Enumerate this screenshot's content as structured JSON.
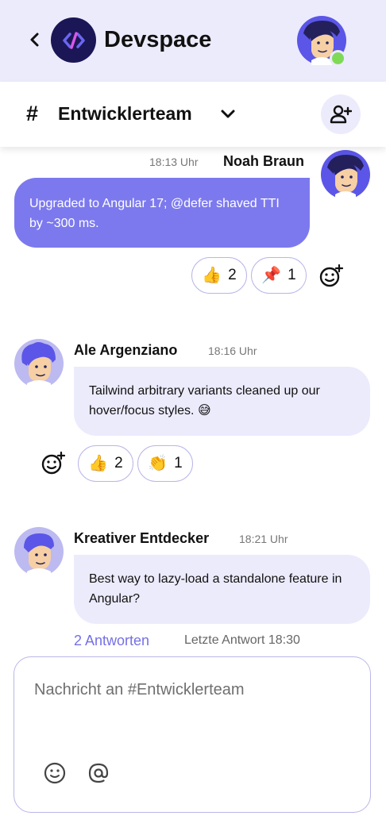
{
  "app": {
    "title": "Devspace",
    "logo_icon": "code-logo-icon",
    "brand_color": "#1b1756",
    "accent_color": "#7c79ee",
    "status": "online"
  },
  "channel": {
    "hash": "#",
    "name": "Entwicklerteam"
  },
  "messages": [
    {
      "author": "Noah Braun",
      "time": "18:13 Uhr",
      "text": "Upgraded to Angular 17; @defer shaved TTI by ~300 ms.",
      "outgoing": true,
      "reactions": [
        {
          "emoji": "👍",
          "count": "2"
        },
        {
          "emoji": "📌",
          "count": "1"
        }
      ]
    },
    {
      "author": "Ale Argenziano",
      "time": "18:16 Uhr",
      "text": "Tailwind arbitrary variants cleaned up our hover/focus styles. 😅",
      "outgoing": false,
      "reactions": [
        {
          "emoji": "👍",
          "count": "2"
        },
        {
          "emoji": "👏",
          "count": "1"
        }
      ]
    },
    {
      "author": "Kreativer Entdecker",
      "time": "18:21 Uhr",
      "text": "Best way to lazy-load a standalone feature in Angular?",
      "outgoing": false,
      "thread": {
        "replies": "2 Antworten",
        "last_reply": "Letzte Antwort 18:30"
      }
    }
  ],
  "composer": {
    "placeholder": "Nachricht an #Entwicklerteam",
    "value": ""
  }
}
